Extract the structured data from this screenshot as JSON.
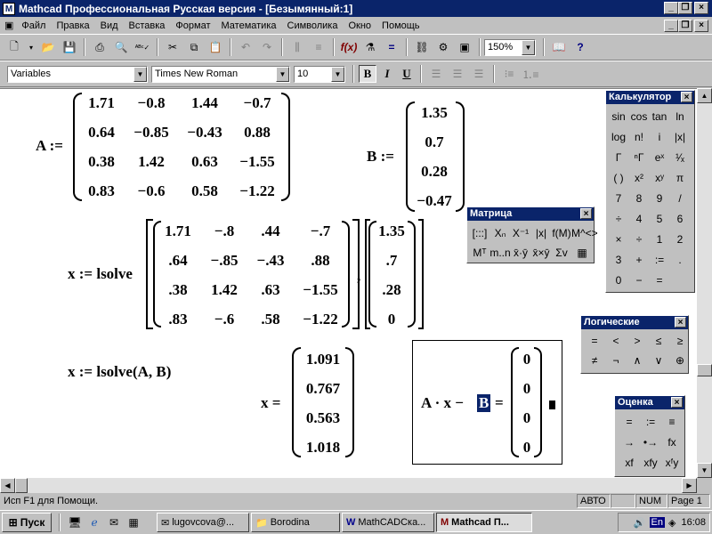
{
  "window": {
    "title": "Mathcad Профессиональная Русская версия - [Безымянный:1]",
    "icon": "mathcad-icon"
  },
  "menu": [
    "Файл",
    "Правка",
    "Вид",
    "Вставка",
    "Формат",
    "Математика",
    "Символика",
    "Окно",
    "Помощь"
  ],
  "format_toolbar": {
    "style": "Variables",
    "font": "Times New Roman",
    "size": "10",
    "bold": "B",
    "italic": "I",
    "underline": "U"
  },
  "zoom": "150%",
  "doc": {
    "a_label": "A :=",
    "a_matrix": [
      [
        "1.71",
        "−0.8",
        "1.44",
        "−0.7"
      ],
      [
        "0.64",
        "−0.85",
        "−0.43",
        "0.88"
      ],
      [
        "0.38",
        "1.42",
        "0.63",
        "−1.55"
      ],
      [
        "0.83",
        "−0.6",
        "0.58",
        "−1.22"
      ]
    ],
    "b_label": "B :=",
    "b_vector": [
      "1.35",
      "0.7",
      "0.28",
      "−0.47"
    ],
    "x1_label": "x := lsolve",
    "lsolve_matrix": [
      [
        "1.71",
        "−.8",
        ".44",
        "−.7"
      ],
      [
        ".64",
        "−.85",
        "−.43",
        ".88"
      ],
      [
        ".38",
        "1.42",
        ".63",
        "−1.55"
      ],
      [
        ".83",
        "−.6",
        ".58",
        "−1.22"
      ]
    ],
    "comma": ",",
    "lsolve_vector": [
      "1.35",
      ".7",
      ".28",
      "0"
    ],
    "x2_label": "x := lsolve(A, B)",
    "x_eq": "x =",
    "x_result": [
      "1.091",
      "0.767",
      "0.563",
      "1.018"
    ],
    "check_a": "A · x −",
    "check_b": "B",
    "check_eq": "=",
    "check_result": [
      "0",
      "0",
      "0",
      "0"
    ]
  },
  "palettes": {
    "calc": {
      "title": "Калькулятор",
      "keys": [
        [
          "sin",
          "cos",
          "tan",
          "ln"
        ],
        [
          "log",
          "n!",
          "i",
          "|x|"
        ],
        [
          "Γ",
          "ⁿΓ",
          "eˣ",
          "¹⁄ₓ"
        ],
        [
          "( )",
          "x²",
          "xʸ",
          "π"
        ],
        [
          "7",
          "8",
          "9",
          "/"
        ],
        [
          "÷",
          "4",
          "5",
          "6"
        ],
        [
          "×",
          "÷",
          "1",
          "2"
        ],
        [
          "3",
          "+",
          ":=",
          "."
        ],
        [
          "0",
          "−",
          "=",
          ""
        ]
      ]
    },
    "matrix": {
      "title": "Матрица",
      "keys": [
        [
          "[:::]",
          "Xₙ",
          "X⁻¹",
          "|x|",
          "f(M)",
          "M^<>"
        ],
        [
          "Mᵀ",
          "m..n",
          "x̄·ȳ",
          "x̄×ȳ",
          "Σv",
          "▦"
        ]
      ]
    },
    "logic": {
      "title": "Логические",
      "keys": [
        [
          "=",
          "<",
          ">",
          "≤",
          "≥"
        ],
        [
          "≠",
          "¬",
          "∧",
          "∨",
          "⊕"
        ]
      ]
    },
    "eval": {
      "title": "Оценка",
      "keys": [
        [
          "=",
          ":=",
          "≡"
        ],
        [
          "→",
          "•→",
          "fx"
        ],
        [
          "xf",
          "xfy",
          "xᶠy"
        ]
      ]
    }
  },
  "status": {
    "help": "Исп F1 для Помощи.",
    "auto": "АВТО",
    "num": "NUM",
    "page": "Page 1"
  },
  "taskbar": {
    "start": "Пуск",
    "tasks": [
      "lugovcova@...",
      "Borodina",
      "MathCADCка...",
      "Mathcad П..."
    ],
    "lang": "En",
    "clock": "16:08"
  }
}
